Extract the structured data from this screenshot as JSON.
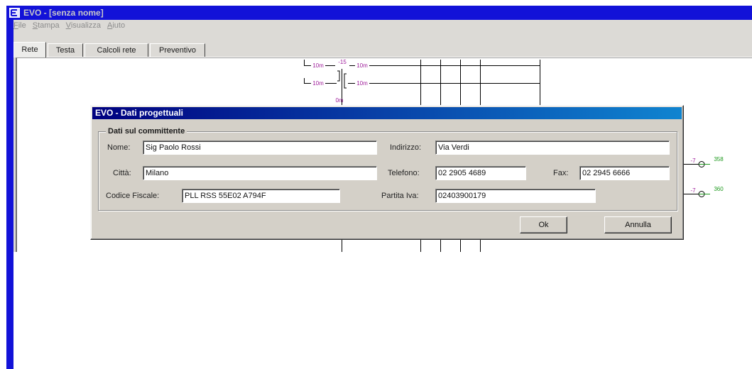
{
  "window": {
    "title": "EVO - [senza nome]",
    "icon": "app-icon"
  },
  "menu": {
    "items": [
      {
        "label": "File"
      },
      {
        "label": "Stampa"
      },
      {
        "label": "Visualizza"
      },
      {
        "label": "Aiuto"
      }
    ]
  },
  "tabs": [
    {
      "label": "Rete",
      "selected": true
    },
    {
      "label": "Testa",
      "selected": false
    },
    {
      "label": "Calcoli rete",
      "selected": false
    },
    {
      "label": "Preventivo",
      "selected": false
    }
  ],
  "diagram": {
    "top_labels": [
      "10m",
      "-15",
      "10m"
    ],
    "bottom_labels": [
      "10m",
      "10m"
    ],
    "center_label": "0m",
    "nodes": [
      {
        "marker": "-7",
        "value": "358"
      },
      {
        "marker": "-7",
        "value": "360"
      }
    ]
  },
  "dialog": {
    "title": "EVO - Dati progettuali",
    "group_title": "Dati sul committente",
    "fields": {
      "nome": {
        "label": "Nome:",
        "value": "Sig Paolo Rossi"
      },
      "indirizzo": {
        "label": "Indirizzo:",
        "value": "Via Verdi"
      },
      "citta": {
        "label": "Città:",
        "value": "Milano"
      },
      "telefono": {
        "label": "Telefono:",
        "value": "02 2905 4689"
      },
      "fax": {
        "label": "Fax:",
        "value": "02 2945 6666"
      },
      "codice_fiscale": {
        "label": "Codice Fiscale:",
        "value": "PLL RSS 55E02 A794F"
      },
      "partita_iva": {
        "label": "Partita Iva:",
        "value": "02403900179"
      }
    },
    "buttons": {
      "ok": "Ok",
      "cancel": "Annulla"
    }
  },
  "colors": {
    "title_bar": "#1212d8",
    "title_text": "#c8c8c8",
    "window_bg": "#dcdad6",
    "menu_text": "#8c8c8c",
    "dialog_bg": "#d4d0c8",
    "dialog_title_from": "#000080",
    "dialog_title_to": "#1084d0",
    "diagram_label": "#a0209c",
    "diagram_value": "#1f9a1f"
  }
}
